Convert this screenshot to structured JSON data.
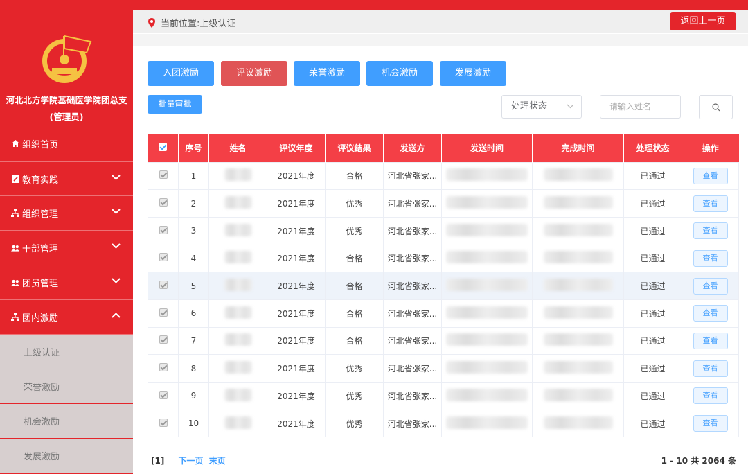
{
  "sidebar": {
    "org_name": "河北北方学院基础医学院团总支",
    "role": "(管理员)",
    "home": "组织首页",
    "items": [
      {
        "label": "教育实践"
      },
      {
        "label": "组织管理"
      },
      {
        "label": "干部管理"
      },
      {
        "label": "团员管理"
      },
      {
        "label": "团内激励"
      }
    ],
    "subitems": [
      "上级认证",
      "荣誉激励",
      "机会激励",
      "发展激励"
    ]
  },
  "header": {
    "breadcrumb": "当前位置:上级认证",
    "back_label": "返回上一页"
  },
  "tabs": [
    "入团激励",
    "评议激励",
    "荣誉激励",
    "机会激励",
    "发展激励"
  ],
  "active_tab": 1,
  "toolbar": {
    "batch_label": "批量审批",
    "status_select": "处理状态",
    "search_placeholder": "请输入姓名"
  },
  "table": {
    "columns": [
      "序号",
      "姓名",
      "评议年度",
      "评议结果",
      "发送方",
      "发送时间",
      "完成时间",
      "处理状态",
      "操作"
    ],
    "rows": [
      {
        "no": "1",
        "year": "2021年度",
        "result": "合格",
        "sender": "河北省张家...",
        "status": "已通过",
        "action": "查看"
      },
      {
        "no": "2",
        "year": "2021年度",
        "result": "优秀",
        "sender": "河北省张家...",
        "status": "已通过",
        "action": "查看"
      },
      {
        "no": "3",
        "year": "2021年度",
        "result": "优秀",
        "sender": "河北省张家...",
        "status": "已通过",
        "action": "查看"
      },
      {
        "no": "4",
        "year": "2021年度",
        "result": "合格",
        "sender": "河北省张家...",
        "status": "已通过",
        "action": "查看"
      },
      {
        "no": "5",
        "year": "2021年度",
        "result": "合格",
        "sender": "河北省张家...",
        "status": "已通过",
        "action": "查看"
      },
      {
        "no": "6",
        "year": "2021年度",
        "result": "合格",
        "sender": "河北省张家...",
        "status": "已通过",
        "action": "查看"
      },
      {
        "no": "7",
        "year": "2021年度",
        "result": "合格",
        "sender": "河北省张家...",
        "status": "已通过",
        "action": "查看"
      },
      {
        "no": "8",
        "year": "2021年度",
        "result": "优秀",
        "sender": "河北省张家...",
        "status": "已通过",
        "action": "查看"
      },
      {
        "no": "9",
        "year": "2021年度",
        "result": "优秀",
        "sender": "河北省张家...",
        "status": "已通过",
        "action": "查看"
      },
      {
        "no": "10",
        "year": "2021年度",
        "result": "优秀",
        "sender": "河北省张家...",
        "status": "已通过",
        "action": "查看"
      }
    ]
  },
  "pagination": {
    "current": "[1]",
    "next": "下一页",
    "last": "末页",
    "summary": "1 - 10 共 2064 条"
  },
  "colors": {
    "brand_red": "#e4252b",
    "primary_blue": "#409eff",
    "active_tab": "#e05456",
    "header_red": "#f43f46"
  }
}
